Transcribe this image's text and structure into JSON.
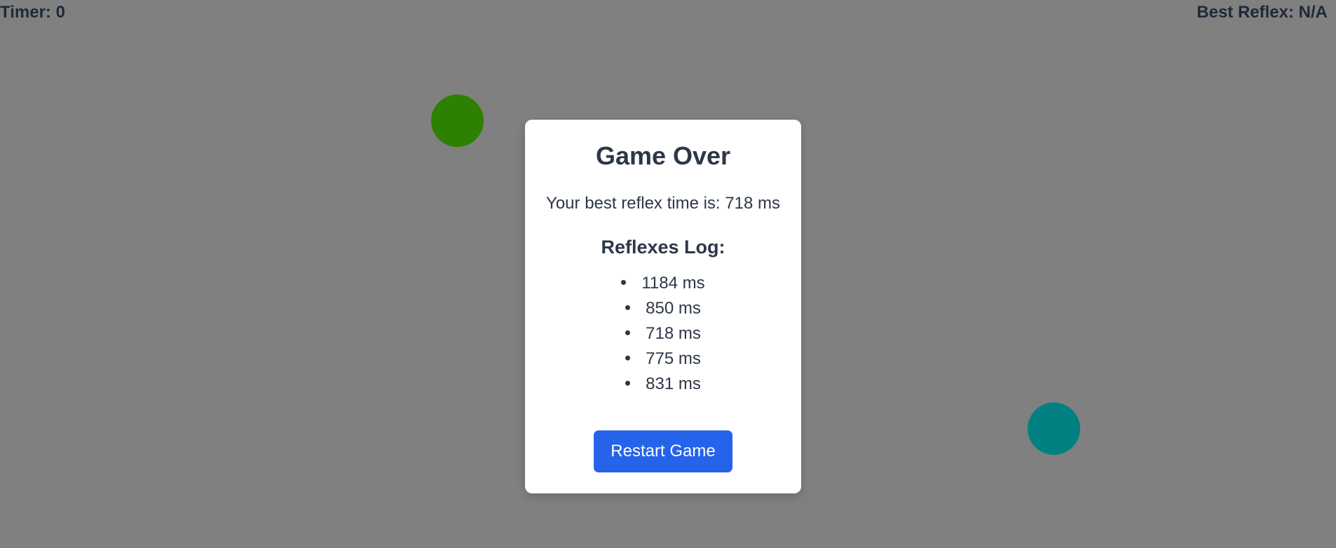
{
  "hud": {
    "timer_label": "Timer:",
    "timer_value": "0",
    "best_label": "Best Reflex:",
    "best_value": "N/A"
  },
  "targets": [
    {
      "name": "green",
      "color": "#2e8000"
    },
    {
      "name": "teal",
      "color": "#008080"
    }
  ],
  "modal": {
    "title": "Game Over",
    "best_text": "Your best reflex time is: 718 ms",
    "log_title": "Reflexes Log:",
    "log_items": [
      "1184 ms",
      "850 ms",
      "718 ms",
      "775 ms",
      "831 ms"
    ],
    "restart_label": "Restart Game"
  },
  "colors": {
    "background": "#808080",
    "button": "#2563eb",
    "text": "#2d3748"
  }
}
